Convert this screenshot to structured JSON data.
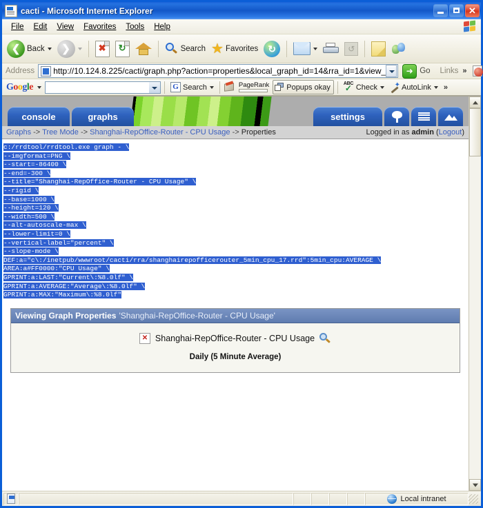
{
  "window": {
    "title": "cacti - Microsoft Internet Explorer",
    "icon": "ie-document-icon",
    "minimize_label": "Minimize",
    "maximize_label": "Maximize",
    "close_label": "Close"
  },
  "menu": {
    "items": [
      {
        "label": "File",
        "accel": "F"
      },
      {
        "label": "Edit",
        "accel": "E"
      },
      {
        "label": "View",
        "accel": "V"
      },
      {
        "label": "Favorites",
        "accel": "a"
      },
      {
        "label": "Tools",
        "accel": "T"
      },
      {
        "label": "Help",
        "accel": "H"
      }
    ]
  },
  "toolbar": {
    "back_label": "Back",
    "forward_label": "Forward",
    "stop_label": "Stop",
    "refresh_label": "Refresh",
    "home_label": "Home",
    "search_label": "Search",
    "favorites_label": "Favorites",
    "history_label": "History",
    "mail_label": "Mail",
    "print_label": "Print",
    "edit_label": "Edit",
    "notes_label": "Notes",
    "messenger_label": "Messenger"
  },
  "address": {
    "label": "Address",
    "url": "http://10.124.8.225/cacti/graph.php?action=properties&local_graph_id=14&rra_id=1&view_",
    "go_label": "Go",
    "links_label": "Links",
    "overflow_label": "»"
  },
  "google_bar": {
    "logo": {
      "g1": "G",
      "o1": "o",
      "o2": "o",
      "g2": "g",
      "l": "l",
      "e": "e"
    },
    "search_value": "",
    "search_label": "Search",
    "pagerank_label": "PageRank",
    "popups_label": "Popups okay",
    "check_label": "Check",
    "autolink_label": "AutoLink",
    "overflow_label": "»"
  },
  "cacti": {
    "tabs": [
      {
        "name": "console",
        "label": "console"
      },
      {
        "name": "graphs",
        "label": "graphs"
      },
      {
        "name": "settings",
        "label": "settings"
      }
    ],
    "icon_tabs": [
      {
        "name": "tree-view",
        "icon": "tree-icon"
      },
      {
        "name": "list-view",
        "icon": "list-icon"
      },
      {
        "name": "preview-view",
        "icon": "mountain-graph-icon"
      }
    ],
    "breadcrumb": {
      "item1": "Graphs",
      "sep1": "->",
      "item2": "Tree Mode",
      "sep2": "->",
      "item3": "Shanghai-RepOffice-Router - CPU Usage",
      "sep3": "->",
      "item4": "Properties"
    },
    "login": {
      "prefix": "Logged in as",
      "user": "admin",
      "logout_open": "(",
      "logout": "Logout",
      "logout_close": ")"
    }
  },
  "rrdtool_command": {
    "lines": [
      "c:/rrdtool/rrdtool.exe graph - \\",
      "--imgformat=PNG \\",
      "--start=-86400 \\",
      "--end=-300 \\",
      "--title=\"Shanghai-RepOffice-Router - CPU Usage\" \\",
      "--rigid \\",
      "--base=1000 \\",
      "--height=120 \\",
      "--width=500 \\",
      "--alt-autoscale-max \\",
      "--lower-limit=0 \\",
      "--vertical-label=\"percent\" \\",
      "--slope-mode \\",
      "DEF:a=\"c\\:/inetpub/wwwroot/cacti/rra/shanghairepofficerouter_5min_cpu_17.rrd\":5min_cpu:AVERAGE \\",
      "AREA:a#FF0000:\"CPU Usage\"  \\",
      "GPRINT:a:LAST:\"Current\\:%8.0lf\"  \\",
      "GPRINT:a:AVERAGE:\"Average\\:%8.0lf\"  \\",
      "GPRINT:a:MAX:\"Maximum\\:%8.0lf\""
    ]
  },
  "graph_properties": {
    "header_title": "Viewing Graph Properties",
    "header_subject": "'Shanghai-RepOffice-Router - CPU Usage'",
    "image_alt": "Shanghai-RepOffice-Router - CPU Usage",
    "broken_image_marker": "x",
    "zoom_icon": "magnifier-icon",
    "caption": "Daily (5 Minute Average)"
  },
  "statusbar": {
    "zone": "Local intranet",
    "zone_icon": "globe-icon",
    "page_icon": "page-icon"
  },
  "colors": {
    "titlebar_blue": "#1257c8",
    "cacti_tab_blue": "#2f63bf",
    "selection_blue": "#2f5fd0",
    "link_blue": "#3a5fbf",
    "banner_green": "#7bd32a",
    "area_red": "#FF0000"
  }
}
